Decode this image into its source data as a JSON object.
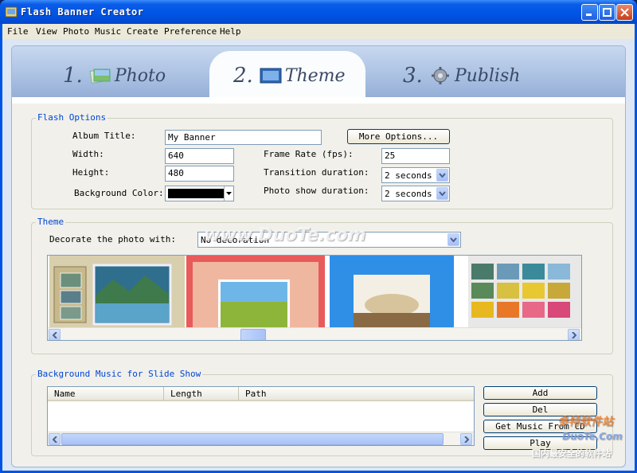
{
  "window": {
    "title": "Flash Banner Creator",
    "colors": {
      "titlebar": "#0054e3",
      "groupTitle": "#0046d5",
      "close": "#c43d18"
    }
  },
  "menu": [
    "File",
    "View",
    "Photo",
    "Music",
    "Create",
    "Preference",
    "Help"
  ],
  "tabs": [
    {
      "num": "1.",
      "label": "Photo",
      "active": false
    },
    {
      "num": "2.",
      "label": "Theme",
      "active": true
    },
    {
      "num": "3.",
      "label": "Publish",
      "active": false
    }
  ],
  "flash_options": {
    "title": "Flash Options",
    "album_title_label": "Album Title:",
    "album_title_value": "My Banner",
    "more_options": "More Options...",
    "width_label": "Width:",
    "width_value": "640",
    "height_label": "Height:",
    "height_value": "480",
    "bg_color_label": "Background Color:",
    "bg_color_value": "#000000",
    "frame_rate_label": "Frame Rate (fps):",
    "frame_rate_value": "25",
    "transition_label": "Transition duration:",
    "transition_value": "2 seconds",
    "photo_show_label": "Photo show duration:",
    "photo_show_value": "2 seconds"
  },
  "theme": {
    "title": "Theme",
    "decorate_label": "Decorate the photo with:",
    "decorate_value": "No decoration"
  },
  "music": {
    "title": "Background Music for Slide Show",
    "columns": [
      "Name",
      "Length",
      "Path"
    ],
    "add": "Add",
    "del": "Del",
    "get_cd": "Get Music From CD",
    "play": "Play"
  },
  "watermark": {
    "site": "www.DuoTe.com",
    "brand_cn": "多特软件站",
    "brand_en": "DuoTe.Com",
    "slogan_cn": "国内最安全的软件站"
  }
}
